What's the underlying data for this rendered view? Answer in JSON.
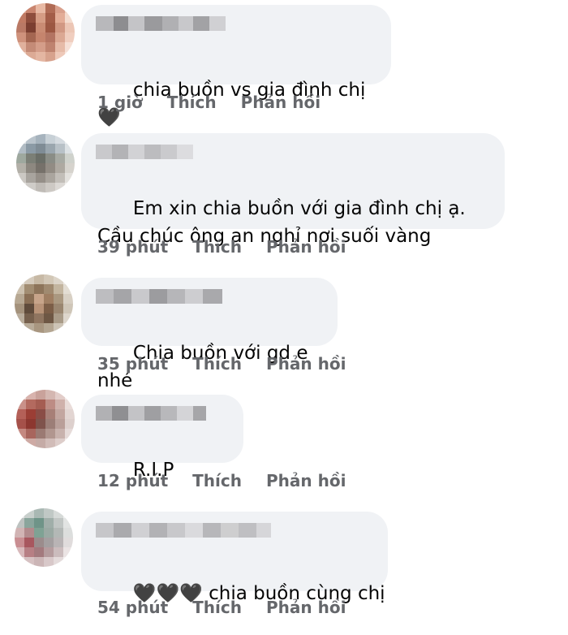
{
  "actions": {
    "like": "Thích",
    "reply": "Phản hồi"
  },
  "colors": {
    "bubble": "#f0f2f5",
    "meta": "#65676b",
    "text": "#050505"
  },
  "comments": [
    {
      "text": "chia buồn vs gia đình chị 🖤",
      "time": "1 giờ"
    },
    {
      "text": "Em xin chia buồn với gia đình chị ạ. Cầu chúc ông an nghỉ nơi suối vàng",
      "time": "39 phút"
    },
    {
      "text": "Chia buồn với gd e nhé",
      "time": "35 phút"
    },
    {
      "text": "R.I.P",
      "time": "12 phút"
    },
    {
      "text": "🖤🖤🖤 chia buồn cùng chị",
      "time": "54 phút"
    }
  ]
}
